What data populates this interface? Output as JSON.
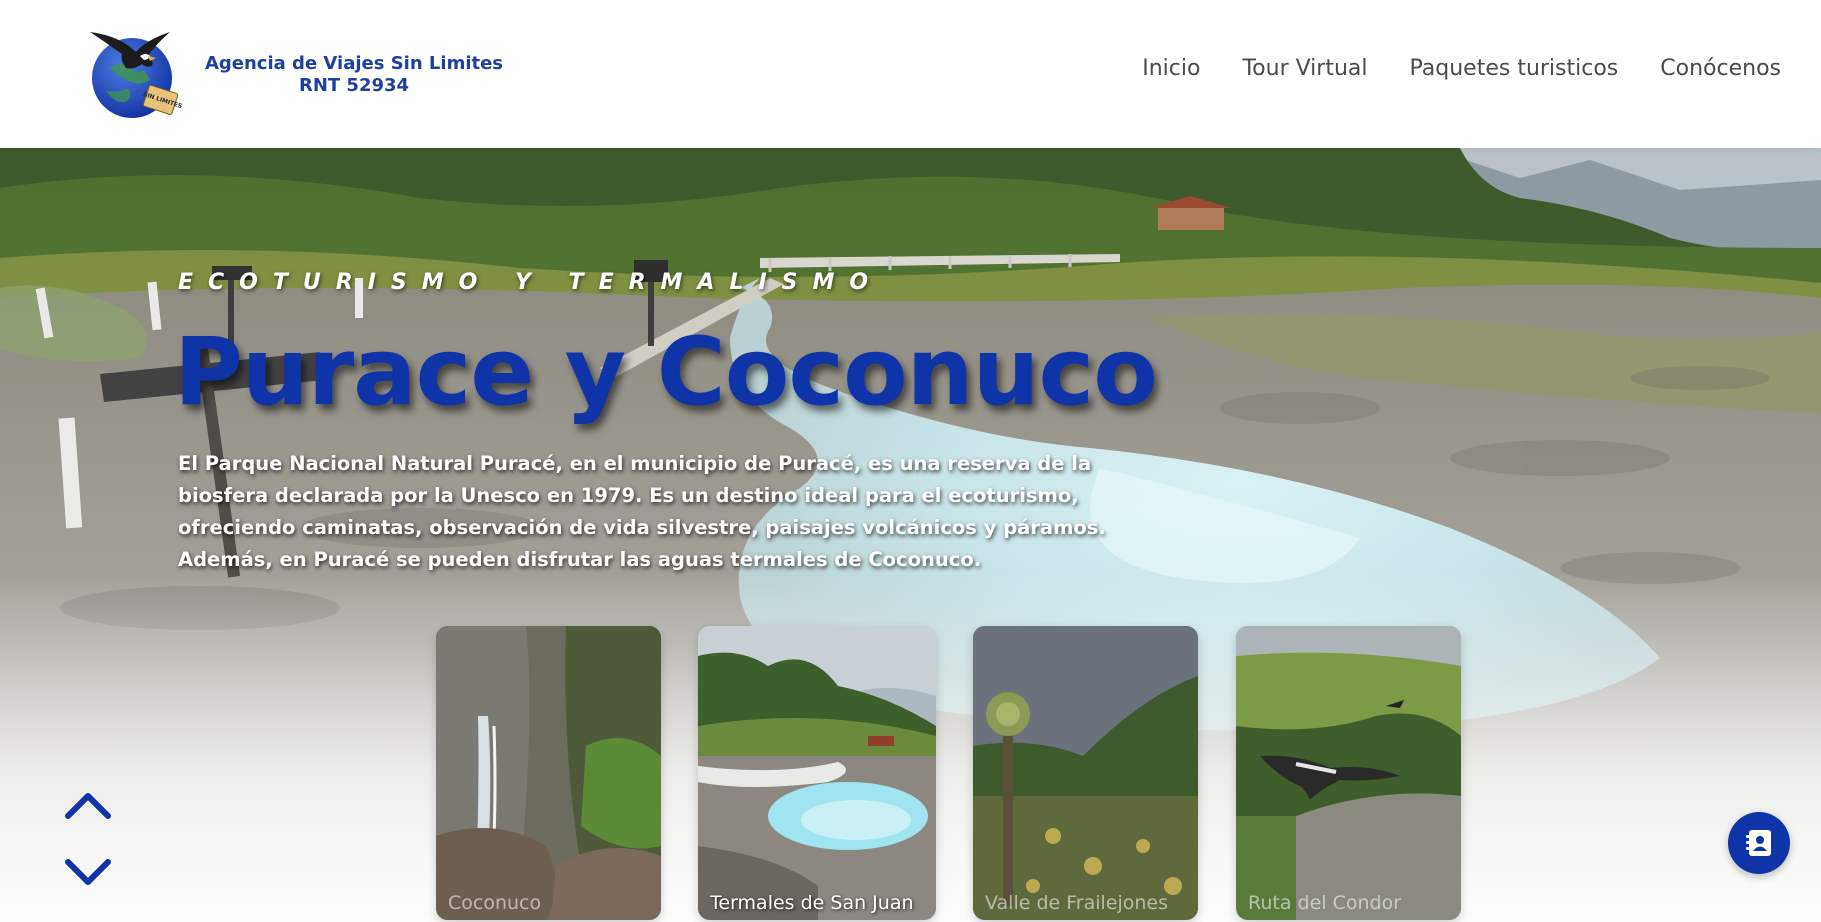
{
  "header": {
    "logo": {
      "agency_name": "Agencia de Viajes Sin Limites",
      "rnt": "RNT 52934",
      "emblem_text": "SIN LIMITES",
      "emblem_icon": "eagle-globe-icon"
    },
    "nav": [
      {
        "label": "Inicio"
      },
      {
        "label": "Tour Virtual"
      },
      {
        "label": "Paquetes turisticos"
      },
      {
        "label": "Conócenos"
      }
    ]
  },
  "hero": {
    "eyebrow": "ECOTURISMO Y TERMALISMO",
    "title": "Purace y Coconuco",
    "description": "El Parque Nacional Natural Puracé, en el municipio de Puracé, es una reserva de la biosfera declarada por la Unesco en 1979. Es un destino ideal para el ecoturismo, ofreciendo caminatas, observación de vida silvestre, paisajes volcánicos y páramos. Además, en Puracé se pueden disfrutar las aguas termales de Coconuco."
  },
  "cards": [
    {
      "label": "Coconuco",
      "active": false
    },
    {
      "label": "Termales de San Juan",
      "active": true
    },
    {
      "label": "Valle de Frailejones",
      "active": false
    },
    {
      "label": "Ruta del Condor",
      "active": false
    }
  ],
  "controls": {
    "up_icon": "chevron-up-icon",
    "down_icon": "chevron-down-icon",
    "contact_icon": "address-book-icon"
  },
  "colors": {
    "brand_blue": "#0e34a8",
    "logo_blue": "#1f3fa3",
    "nav_text": "#4b4b4b"
  }
}
